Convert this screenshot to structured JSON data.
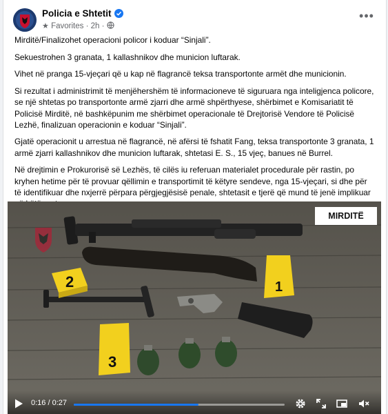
{
  "post": {
    "page_name": "Policia e Shtetit",
    "audience_label": "Favorites",
    "separator": "·",
    "time_ago": "2h",
    "paragraphs": [
      "Mirditë/Finalizohet operacioni policor i koduar “Sinjali”.",
      "Sekuestrohen 3 granata, 1 kallashnikov dhe municion luftarak.",
      "Vihet në pranga 15-vjeçari që u kap në flagrancë teksa transportonte armët dhe municionin.",
      "Si rezultat i administrimit të menjëhershëm të informacioneve të siguruara nga inteligjenca policore, se një shtetas po transportonte armë zjarri dhe armë shpërthyese, shërbimet e Komisariatit të Policisë Mirditë, në bashkëpunim me shërbimet operacionale të Drejtorisë Vendore të Policisë Lezhë, finalizuan operacionin e koduar “Sinjali”.",
      "Gjatë operacionit u arrestua në flagrancë, në afërsi të fshatit Fang, teksa transportonte 3 granata, 1 armë zjarri kallashnikov dhe municion luftarak, shtetasi E. S., 15 vjeç, banues në Burrel.",
      "Në drejtimin e Prokurorisë së Lezhës, të cilës iu referuan materialet procedurale për rastin, po kryhen hetime për të provuar qëllimin e transportimit të këtyre sendeve, nga 15-vjeçari, si dhe për të identifikuar dhe nxjerrë përpara përgjegjësisë penale, shtetasit e tjerë që mund të jenë implikuar në këtë rast."
    ]
  },
  "video": {
    "region_tag": "MIRDITË",
    "evidence_markers": [
      "1",
      "2",
      "3"
    ],
    "current_time": "0:16",
    "time_separator": "/",
    "duration": "0:27",
    "progress_fraction": 0.59
  },
  "icons": {
    "more": "more-horizontal-icon",
    "star": "star-icon",
    "globe": "globe-icon",
    "verified": "verified-badge-icon",
    "play": "play-icon",
    "settings": "gear-icon",
    "fullscreen": "expand-icon",
    "pip": "picture-in-picture-icon",
    "mute": "volume-muted-icon"
  },
  "colors": {
    "accent": "#1877f2",
    "marker_yellow": "#f2d01e",
    "meta_gray": "#65676b"
  }
}
